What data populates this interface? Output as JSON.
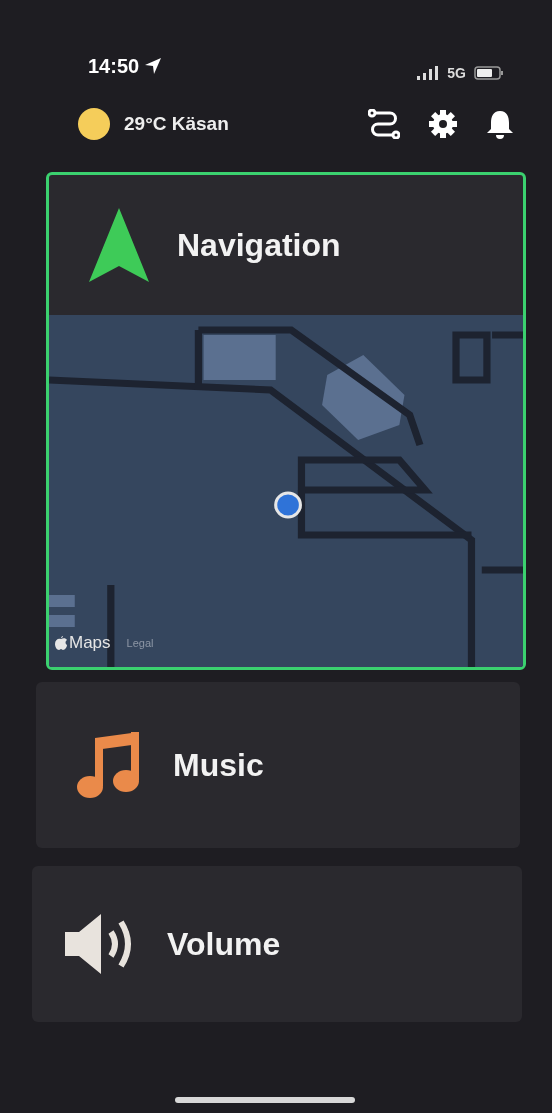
{
  "status_bar": {
    "time": "14:50",
    "network": "5G"
  },
  "header": {
    "weather": "29°C Käsan"
  },
  "cards": [
    {
      "kind": "navigation",
      "title": "Navigation",
      "selected": true,
      "map": {
        "attribution": "Maps",
        "legal": "Legal"
      }
    },
    {
      "kind": "music",
      "title": "Music",
      "selected": false
    },
    {
      "kind": "volume",
      "title": "Volume",
      "selected": false
    }
  ]
}
